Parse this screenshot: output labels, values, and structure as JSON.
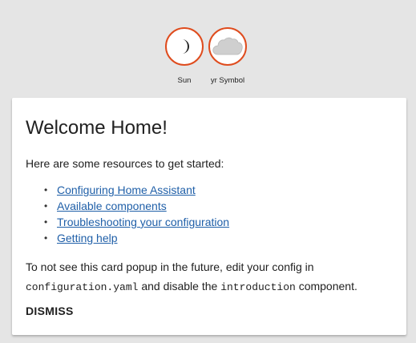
{
  "badges": [
    {
      "label": "Sun",
      "icon": "moon-icon"
    },
    {
      "label": "yr Symbol",
      "icon": "cloud-icon"
    }
  ],
  "colors": {
    "badge_border": "#df4c1e",
    "link": "#1f5fa8",
    "background": "#e5e5e5",
    "card": "#ffffff"
  },
  "card": {
    "title": "Welcome Home!",
    "intro": "Here are some resources to get started:",
    "links": [
      "Configuring Home Assistant",
      "Available components",
      "Troubleshooting your configuration",
      "Getting help"
    ],
    "footer": {
      "part1": "To not see this card popup in the future, edit your config in",
      "code1": "configuration.yaml",
      "part2": " and disable the ",
      "code2": "introduction",
      "part3": " component."
    },
    "dismiss_label": "DISMISS"
  }
}
